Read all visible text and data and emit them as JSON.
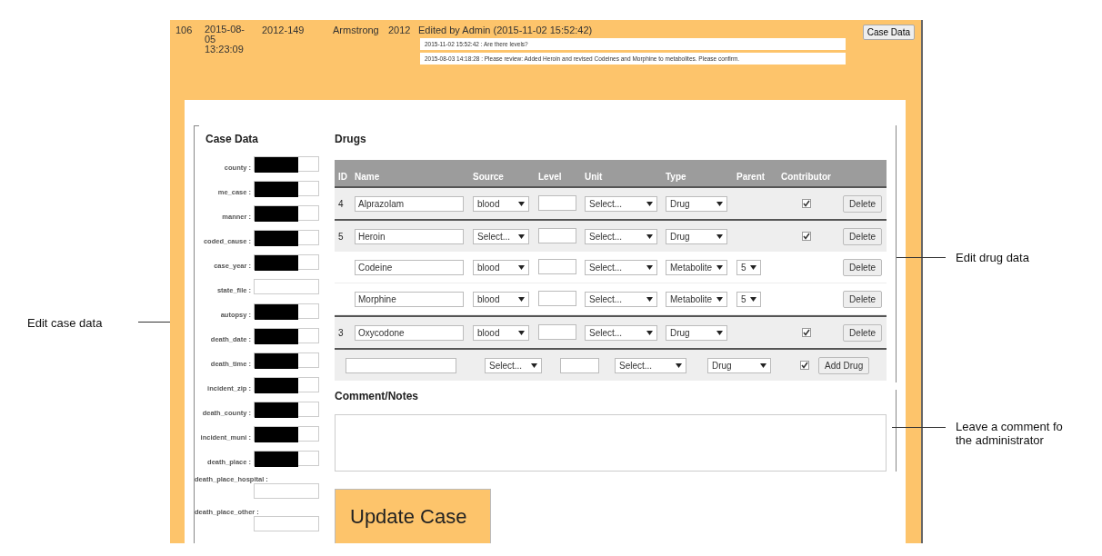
{
  "record": {
    "id": "106",
    "created": "2015-08-05 13:23:09",
    "case_number": "2012-149",
    "county": "Armstrong",
    "year": "2012",
    "status": "Edited by Admin (2015-11-02 15:52:42)",
    "comments": [
      "2015-11-02 15:52:42 : Are there levels?",
      "2015-08-03 14:18:28 : Please review: Added Heroin and revised Codeines and Morphine to metabolites. Please confirm."
    ],
    "button": "Case Data"
  },
  "case_data": {
    "title": "Case Data",
    "fields": [
      {
        "label": "county :",
        "redacted": true
      },
      {
        "label": "me_case :",
        "redacted": true
      },
      {
        "label": "manner :",
        "redacted": true
      },
      {
        "label": "coded_cause :",
        "redacted": true
      },
      {
        "label": "case_year :",
        "redacted": true
      },
      {
        "label": "state_file :",
        "redacted": false
      },
      {
        "label": "autopsy :",
        "redacted": true
      },
      {
        "label": "death_date :",
        "redacted": true
      },
      {
        "label": "death_time :",
        "redacted": true
      },
      {
        "label": "incident_zip :",
        "redacted": true
      },
      {
        "label": "death_county :",
        "redacted": true
      },
      {
        "label": "incident_muni :",
        "redacted": true
      },
      {
        "label": "death_place :",
        "redacted": true
      },
      {
        "label": "death_place_hospital :",
        "redacted": false
      },
      {
        "label": "death_place_other :",
        "redacted": false
      }
    ]
  },
  "drugs": {
    "title": "Drugs",
    "columns": [
      "ID",
      "Name",
      "Source",
      "Level",
      "Unit",
      "Type",
      "Parent",
      "Contributor"
    ],
    "rows": [
      {
        "kind": "drug",
        "id": "4",
        "name": "Alprazolam",
        "source": "blood",
        "unit": "Select...",
        "type": "Drug",
        "contributor": true,
        "button": "Delete"
      },
      {
        "kind": "drug",
        "id": "5",
        "name": "Heroin",
        "source": "Select...",
        "unit": "Select...",
        "type": "Drug",
        "contributor": true,
        "button": "Delete"
      },
      {
        "kind": "metabolite",
        "name": "Codeine",
        "source": "blood",
        "unit": "Select...",
        "type": "Metabolite",
        "parent": "5",
        "button": "Delete"
      },
      {
        "kind": "metabolite",
        "name": "Morphine",
        "source": "blood",
        "unit": "Select...",
        "type": "Metabolite",
        "parent": "5",
        "button": "Delete"
      },
      {
        "kind": "drug",
        "id": "3",
        "name": "Oxycodone",
        "source": "blood",
        "unit": "Select...",
        "type": "Drug",
        "contributor": true,
        "button": "Delete"
      }
    ],
    "add_row": {
      "source": "Select...",
      "unit": "Select...",
      "type": "Drug",
      "contributor": true,
      "button": "Add Drug"
    }
  },
  "comment": {
    "title": "Comment/Notes"
  },
  "submit": "Update Case",
  "annotations": {
    "case": "Edit case data",
    "drugs": "Edit drug data",
    "comment": "Leave a comment fo the administrator"
  }
}
